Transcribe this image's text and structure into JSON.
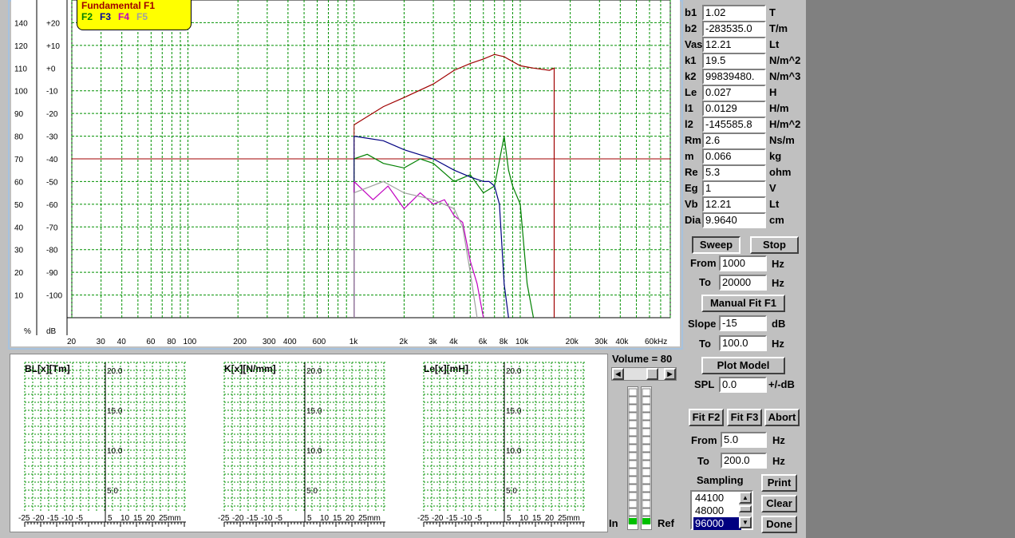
{
  "legend": {
    "title": "Fundamental F1",
    "items": [
      {
        "label": "F2",
        "color": "#008000"
      },
      {
        "label": "F3",
        "color": "#0000a0"
      },
      {
        "label": "F4",
        "color": "#c000c0"
      },
      {
        "label": "F5",
        "color": "#a0a0a0"
      }
    ]
  },
  "left_axis": {
    "pct_ticks": [
      "140",
      "120",
      "110",
      "100",
      "90",
      "80",
      "70",
      "60",
      "50",
      "40",
      "30",
      "20",
      "10"
    ],
    "db_ticks": [
      "+20",
      "+10",
      "+0",
      "-10",
      "-20",
      "-30",
      "-40",
      "-50",
      "-60",
      "-70",
      "-80",
      "-90",
      "-100"
    ],
    "pct_unit": "%",
    "db_unit": "dB"
  },
  "freq_axis": {
    "ticks": [
      "20",
      "30",
      "40",
      "60",
      "80",
      "100",
      "200",
      "300",
      "400",
      "600",
      "1k",
      "2k",
      "3k",
      "4k",
      "6k",
      "8k",
      "10k",
      "20k",
      "30k",
      "40k",
      "60k",
      "Hz"
    ]
  },
  "colors": {
    "f1": "#a00000",
    "f2": "#008000",
    "f3": "#000080",
    "f4": "#c000c0",
    "f5": "#a0a0a0",
    "grid": "#009000",
    "ref": "#a00000"
  },
  "chart_data": {
    "type": "line",
    "x_scale": "log",
    "xlim": [
      20,
      80000
    ],
    "ylim_db": [
      -110,
      30
    ],
    "reference_line_db": -40,
    "series": [
      {
        "name": "Fundamental F1",
        "x": [
          1000,
          1500,
          2000,
          3000,
          4000,
          5000,
          6000,
          7000,
          8000,
          10000,
          12000,
          15000,
          16000
        ],
        "y": [
          -25,
          -17,
          -13,
          -7,
          -1,
          2,
          4,
          6,
          5,
          1,
          0,
          -1,
          0
        ]
      },
      {
        "name": "F2",
        "x": [
          1000,
          1200,
          1500,
          2000,
          2500,
          3000,
          4000,
          5000,
          6000,
          7000,
          8000,
          8500,
          9000,
          10000,
          11000,
          12000
        ],
        "y": [
          -40,
          -38,
          -42,
          -44,
          -40,
          -42,
          -50,
          -47,
          -55,
          -52,
          -30,
          -45,
          -52,
          -60,
          -95,
          -110
        ]
      },
      {
        "name": "F3",
        "x": [
          1000,
          1500,
          2000,
          3000,
          4000,
          5000,
          6000,
          6500,
          7000,
          7500,
          8000,
          8500
        ],
        "y": [
          -30,
          -32,
          -36,
          -40,
          -45,
          -48,
          -50,
          -50,
          -52,
          -60,
          -95,
          -110
        ]
      },
      {
        "name": "F4",
        "x": [
          1000,
          1300,
          1600,
          2000,
          2500,
          3000,
          3500,
          4000,
          4500,
          5000,
          5500,
          6000
        ],
        "y": [
          -50,
          -58,
          -52,
          -62,
          -55,
          -60,
          -58,
          -65,
          -68,
          -85,
          -95,
          -110
        ]
      },
      {
        "name": "F5",
        "x": [
          1000,
          1500,
          2000,
          3000,
          4000,
          4500,
          5000,
          5500
        ],
        "y": [
          -55,
          -50,
          -55,
          -58,
          -62,
          -70,
          -90,
          -110
        ]
      }
    ]
  },
  "params": [
    {
      "label": "b1",
      "value": "1.02",
      "unit": "T"
    },
    {
      "label": "b2",
      "value": "-283535.0",
      "unit": "T/m"
    },
    {
      "label": "Vas",
      "value": "12.21",
      "unit": "Lt"
    },
    {
      "label": "k1",
      "value": "19.5",
      "unit": "N/m^2"
    },
    {
      "label": "k2",
      "value": "99839480.",
      "unit": "N/m^3"
    },
    {
      "label": "Le",
      "value": "0.027",
      "unit": "H"
    },
    {
      "label": "l1",
      "value": "0.0129",
      "unit": "H/m"
    },
    {
      "label": "l2",
      "value": "-145585.8",
      "unit": "H/m^2"
    },
    {
      "label": "Rm",
      "value": "2.6",
      "unit": "Ns/m"
    },
    {
      "label": "m",
      "value": "0.066",
      "unit": "kg"
    },
    {
      "label": "Re",
      "value": "5.3",
      "unit": "ohm"
    },
    {
      "label": "Eg",
      "value": "1",
      "unit": "V"
    },
    {
      "label": "Vb",
      "value": "12.21",
      "unit": "Lt"
    },
    {
      "label": "Dia",
      "value": "9.9640",
      "unit": "cm"
    }
  ],
  "sweep": {
    "sweep_label": "Sweep",
    "stop_label": "Stop",
    "from_label": "From",
    "from_value": "1000",
    "from_unit": "Hz",
    "to_label": "To",
    "to_value": "20000",
    "to_unit": "Hz",
    "manual_fit_label": "Manual Fit F1",
    "slope_label": "Slope",
    "slope_value": "-15",
    "slope_unit": "dB",
    "to2_label": "To",
    "to2_value": "100.0",
    "to2_unit": "Hz",
    "plot_model_label": "Plot Model",
    "spl_label": "SPL",
    "spl_value": "0.0",
    "spl_unit": "+/-dB"
  },
  "fit": {
    "fit_f2": "Fit F2",
    "fit_f3": "Fit F3",
    "abort": "Abort",
    "from_label": "From",
    "from_value": "5.0",
    "from_unit": "Hz",
    "to_label": "To",
    "to_value": "200.0",
    "to_unit": "Hz"
  },
  "sampling": {
    "label": "Sampling",
    "options": [
      "44100",
      "48000",
      "96000"
    ],
    "selected": "96000",
    "print": "Print",
    "clear": "Clear",
    "done": "Done"
  },
  "volume": {
    "label": "Volume = 80",
    "value": 80,
    "in_label": "In",
    "ref_label": "Ref"
  },
  "nonlinear_plots": [
    {
      "title": "BL[x][Tm]"
    },
    {
      "title": "K[x][N/mm]"
    },
    {
      "title": "Le[x][mH]"
    }
  ],
  "nl_y_ticks": [
    "20.0",
    "15.0",
    "10.0",
    "5.0"
  ],
  "nl_x_ticks": [
    "-25",
    "-20",
    "-15",
    "-10",
    "-5",
    "5",
    "10",
    "15",
    "20",
    "25mm"
  ]
}
